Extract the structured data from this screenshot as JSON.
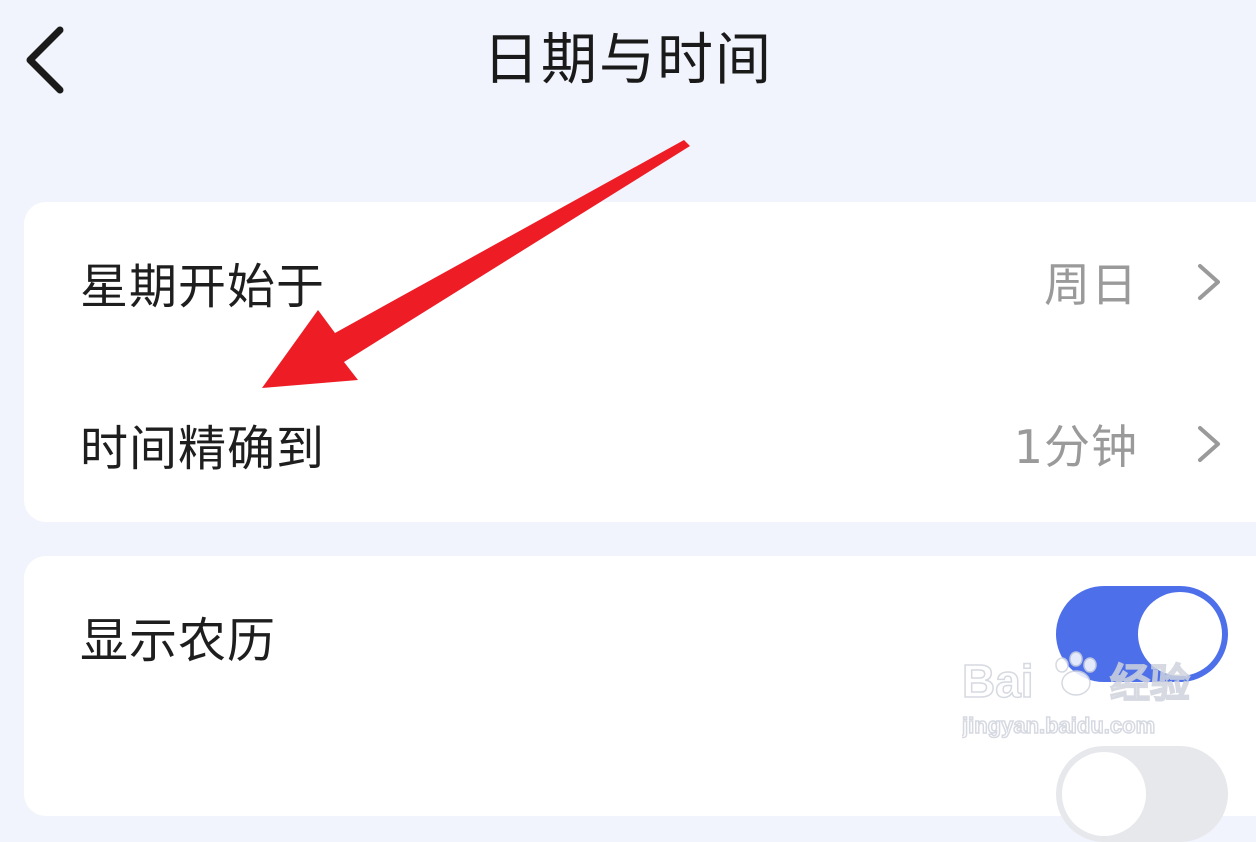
{
  "header": {
    "title": "日期与时间",
    "back_icon": "chevron-left-icon"
  },
  "settings_group_1": [
    {
      "label": "星期开始于",
      "value": "周日",
      "icon": "chevron-right-icon"
    },
    {
      "label": "时间精确到",
      "value": "1分钟",
      "icon": "chevron-right-icon"
    }
  ],
  "settings_group_2": [
    {
      "label": "显示农历",
      "toggle_on": true
    }
  ],
  "colors": {
    "background": "#f1f4fc",
    "card": "#ffffff",
    "accent": "#4d6fea",
    "annotation_arrow": "#ee1c24"
  },
  "watermark": {
    "logo_text": "Bai du 经验",
    "url_text": "jingyan.baidu.com"
  }
}
